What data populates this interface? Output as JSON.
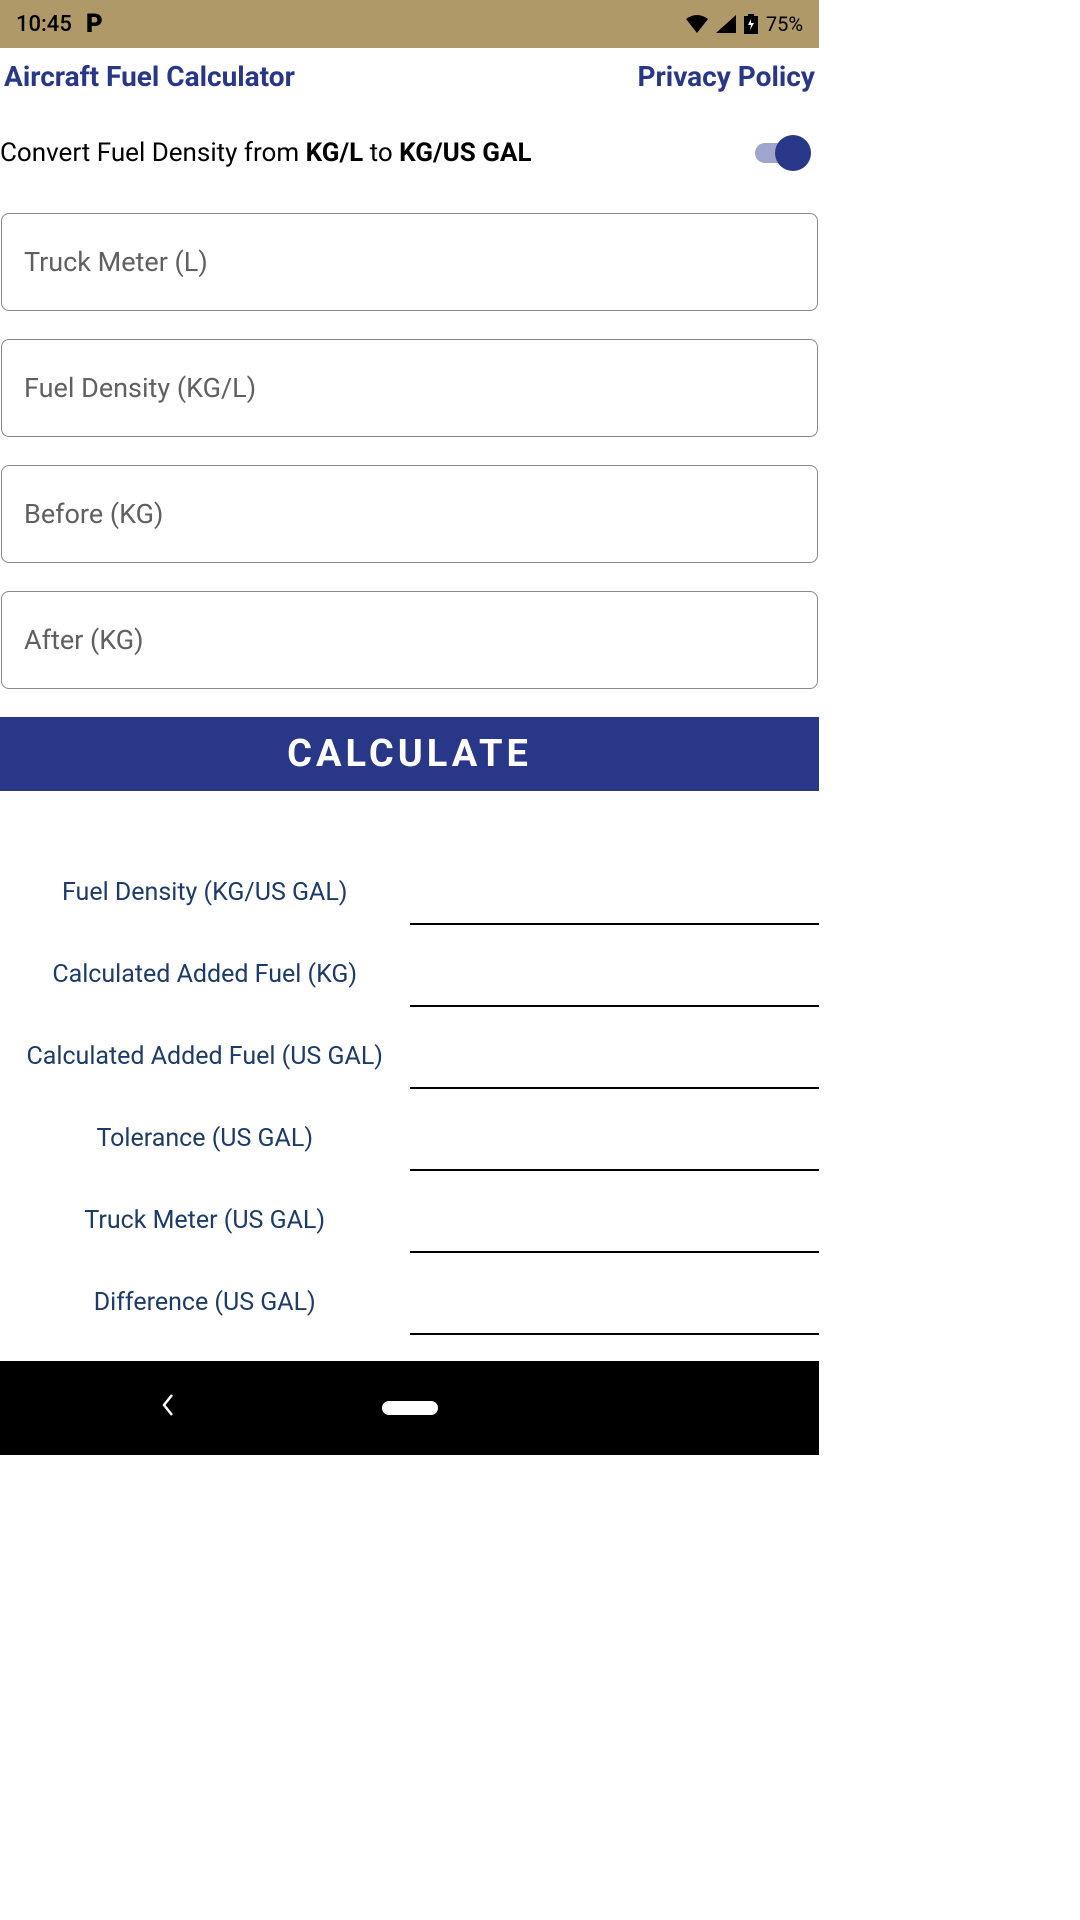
{
  "status": {
    "time": "10:45",
    "battery": "75%"
  },
  "header": {
    "title": "Aircraft Fuel Calculator",
    "privacy": "Privacy Policy"
  },
  "toggle": {
    "prefix": "Convert Fuel Density from ",
    "from": "KG/L",
    "mid": " to ",
    "to": "KG/US GAL"
  },
  "inputs": {
    "truck_meter": "Truck Meter (L)",
    "fuel_density": "Fuel Density (KG/L)",
    "before": "Before (KG)",
    "after": "After (KG)"
  },
  "calculate": "CALCULATE",
  "results": {
    "fuel_density": "Fuel Density (KG/US GAL)",
    "calc_added_kg": "Calculated Added Fuel (KG)",
    "calc_added_gal": "Calculated Added Fuel (US GAL)",
    "tolerance": "Tolerance (US GAL)",
    "truck_meter_gal": "Truck Meter (US GAL)",
    "difference": "Difference (US GAL)"
  }
}
